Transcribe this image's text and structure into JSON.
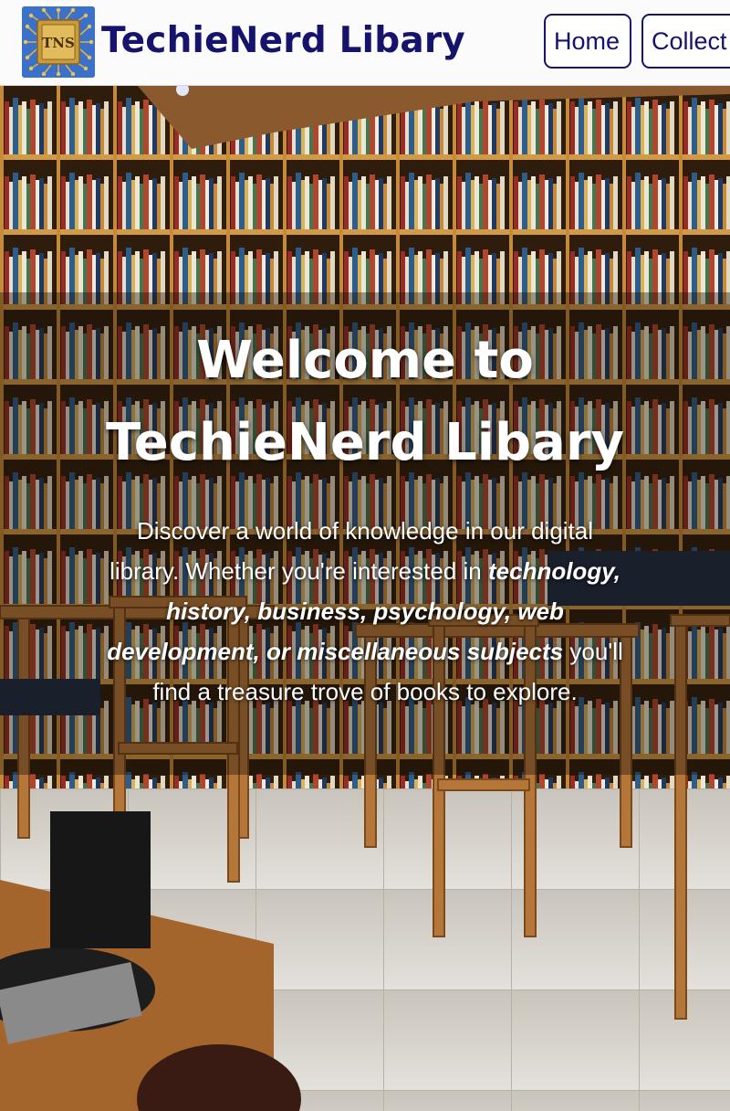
{
  "header": {
    "logo_text": "TNS",
    "brand": "TechieNerd Libary",
    "nav": {
      "home": "Home",
      "collection": "Collect"
    }
  },
  "hero": {
    "title_line1": "Welcome to",
    "title_line2": "TechieNerd Libary",
    "intro": "Discover a world of knowledge in our digital library. Whether you're interested in",
    "subjects": "technology, history, business, psychology, web development, or miscellaneous subjects",
    "outro": "you'll find a treasure trove of books to explore."
  },
  "colors": {
    "brand": "#15136b",
    "header_bg": "#fbfbfc",
    "hero_text": "#ffffff"
  }
}
